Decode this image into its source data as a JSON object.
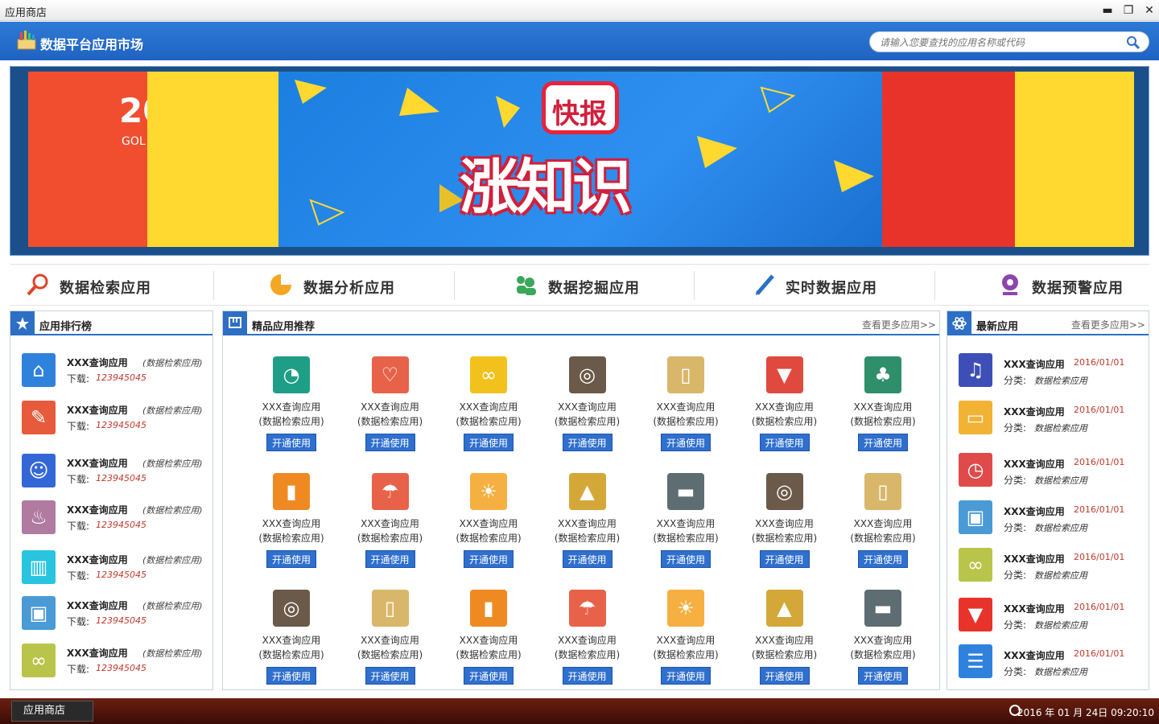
{
  "window": {
    "title": "应用商店",
    "minimize": "▬",
    "restore": "❐",
    "close": "✕"
  },
  "header": {
    "app_title": "数据平台应用市场",
    "search_placeholder": "请输入您要查找的应用名称或代码"
  },
  "banner": {
    "badge": "快报",
    "headline": "涨知识",
    "left_text": "20",
    "left_sub": "GOL"
  },
  "categories": [
    {
      "label": "数据检索应用",
      "icon": "search-icon",
      "color": "#e0442a"
    },
    {
      "label": "数据分析应用",
      "icon": "pie-chart-icon",
      "color": "#f5a623"
    },
    {
      "label": "数据挖掘应用",
      "icon": "users-icon",
      "color": "#3aa75a"
    },
    {
      "label": "实时数据应用",
      "icon": "pen-icon",
      "color": "#2c6fc4"
    },
    {
      "label": "数据预警应用",
      "icon": "alert-icon",
      "color": "#8e44ad"
    }
  ],
  "ranking": {
    "title": "应用排行榜",
    "download_label": "下载:",
    "items": [
      {
        "name": "XXX查询应用",
        "category": "(数据检索应用)",
        "downloads": "123945045",
        "icon": "home-icon",
        "color": "#2f82dc"
      },
      {
        "name": "XXX查询应用",
        "category": "(数据检索应用)",
        "downloads": "123945045",
        "icon": "pencil-icon",
        "color": "#e85a3c"
      },
      {
        "name": "XXX查询应用",
        "category": "(数据检索应用)",
        "downloads": "123945045",
        "icon": "user-icon",
        "color": "#3367d6"
      },
      {
        "name": "XXX查询应用",
        "category": "(数据检索应用)",
        "downloads": "123945045",
        "icon": "bulb-icon",
        "color": "#b07aa1"
      },
      {
        "name": "XXX查询应用",
        "category": "(数据检索应用)",
        "downloads": "123945045",
        "icon": "trash-icon",
        "color": "#29c4e0"
      },
      {
        "name": "XXX查询应用",
        "category": "(数据检索应用)",
        "downloads": "123945045",
        "icon": "image-icon",
        "color": "#4a9ad6"
      },
      {
        "name": "XXX查询应用",
        "category": "(数据检索应用)",
        "downloads": "123945045",
        "icon": "link-icon",
        "color": "#b9c44a"
      }
    ]
  },
  "featured": {
    "title": "精品应用推荐",
    "more": "查看更多应用>>",
    "button_label": "开通使用",
    "name": "XXX查询应用",
    "category": "(数据检索应用)",
    "items": [
      {
        "icon": "ball-icon",
        "color": "#1f9e87"
      },
      {
        "icon": "bikini-icon",
        "color": "#e8624a"
      },
      {
        "icon": "glasses-icon",
        "color": "#f2c11c"
      },
      {
        "icon": "lifebuoy-icon",
        "color": "#6b5a4a"
      },
      {
        "icon": "popsicle-icon",
        "color": "#d9b76a"
      },
      {
        "icon": "icecream-icon",
        "color": "#e04a3e"
      },
      {
        "icon": "palm-icon",
        "color": "#2f8f6a"
      },
      {
        "icon": "flipflop-icon",
        "color": "#ef8a23"
      },
      {
        "icon": "umbrella-icon",
        "color": "#e8624a"
      },
      {
        "icon": "sun-icon",
        "color": "#f5b041"
      },
      {
        "icon": "sailboat-icon",
        "color": "#d4a838"
      },
      {
        "icon": "shorts-icon",
        "color": "#5d6d72"
      },
      {
        "icon": "lifebuoy-icon",
        "color": "#6b5a4a"
      },
      {
        "icon": "popsicle-icon",
        "color": "#d9b76a"
      },
      {
        "icon": "lifebuoy-icon",
        "color": "#6b5a4a"
      },
      {
        "icon": "popsicle-icon",
        "color": "#d9b76a"
      },
      {
        "icon": "flipflop-icon",
        "color": "#ef8a23"
      },
      {
        "icon": "umbrella-icon",
        "color": "#e8624a"
      },
      {
        "icon": "sun-icon",
        "color": "#f5b041"
      },
      {
        "icon": "sailboat-icon",
        "color": "#d4a838"
      },
      {
        "icon": "shorts-icon",
        "color": "#5d6d72"
      }
    ]
  },
  "latest": {
    "title": "最新应用",
    "more": "查看更多应用>>",
    "category_label": "分类:",
    "items": [
      {
        "name": "XXX查询应用",
        "date": "2016/01/01",
        "category": "数据检索应用",
        "icon": "music-icon",
        "color": "#3d4fb6"
      },
      {
        "name": "XXX查询应用",
        "date": "2016/01/01",
        "category": "数据检索应用",
        "icon": "card-icon",
        "color": "#f2b233"
      },
      {
        "name": "XXX查询应用",
        "date": "2016/01/01",
        "category": "数据检索应用",
        "icon": "clock-icon",
        "color": "#e04a4a"
      },
      {
        "name": "XXX查询应用",
        "date": "2016/01/01",
        "category": "数据检索应用",
        "icon": "image-icon",
        "color": "#4a9ad6"
      },
      {
        "name": "XXX查询应用",
        "date": "2016/01/01",
        "category": "数据检索应用",
        "icon": "link-icon",
        "color": "#b9c44a"
      },
      {
        "name": "XXX查询应用",
        "date": "2016/01/01",
        "category": "数据检索应用",
        "icon": "thumbs-down-icon",
        "color": "#e8332b"
      },
      {
        "name": "XXX查询应用",
        "date": "2016/01/01",
        "category": "数据检索应用",
        "icon": "list-icon",
        "color": "#2f82dc"
      }
    ]
  },
  "taskbar": {
    "task_label": "应用商店",
    "clock": "2016 年 01 月 24日 09:20:10"
  }
}
